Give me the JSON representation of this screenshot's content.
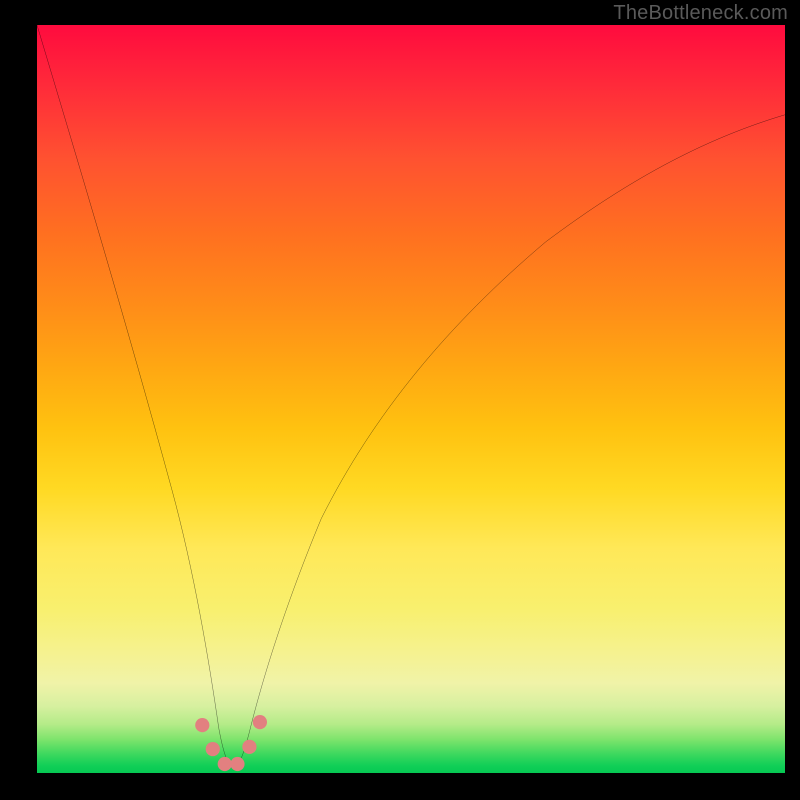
{
  "watermark": "TheBottleneck.com",
  "chart_data": {
    "type": "line",
    "title": "",
    "xlabel": "",
    "ylabel": "",
    "xlim": [
      0,
      100
    ],
    "ylim": [
      0,
      100
    ],
    "background_gradient": {
      "direction": "vertical",
      "stops": [
        {
          "pos": 0,
          "color": "#ff0b3e"
        },
        {
          "pos": 50,
          "color": "#ffc210"
        },
        {
          "pos": 85,
          "color": "#f5f290"
        },
        {
          "pos": 100,
          "color": "#06c953"
        }
      ]
    },
    "x": [
      0,
      3,
      6,
      9,
      12,
      15,
      18,
      21,
      23,
      24.5,
      25.5,
      26.5,
      28,
      29,
      30.5,
      33,
      36,
      40,
      45,
      50,
      56,
      63,
      71,
      80,
      90,
      100
    ],
    "values": [
      100,
      90,
      79,
      68,
      56,
      44,
      31,
      18,
      9,
      3.5,
      1,
      0.5,
      1,
      3,
      7,
      14,
      22,
      31,
      41,
      50,
      58,
      65,
      71.5,
      77,
      82,
      86
    ],
    "markers": {
      "x": [
        21.5,
        23,
        24.7,
        26.2,
        27.8,
        29.2
      ],
      "y": [
        5,
        2,
        0.8,
        0.8,
        2.2,
        5
      ],
      "color": "#e28080",
      "size": 8
    }
  },
  "colors": {
    "curve": "#000000",
    "marker": "#e28080",
    "frame": "#000000"
  }
}
